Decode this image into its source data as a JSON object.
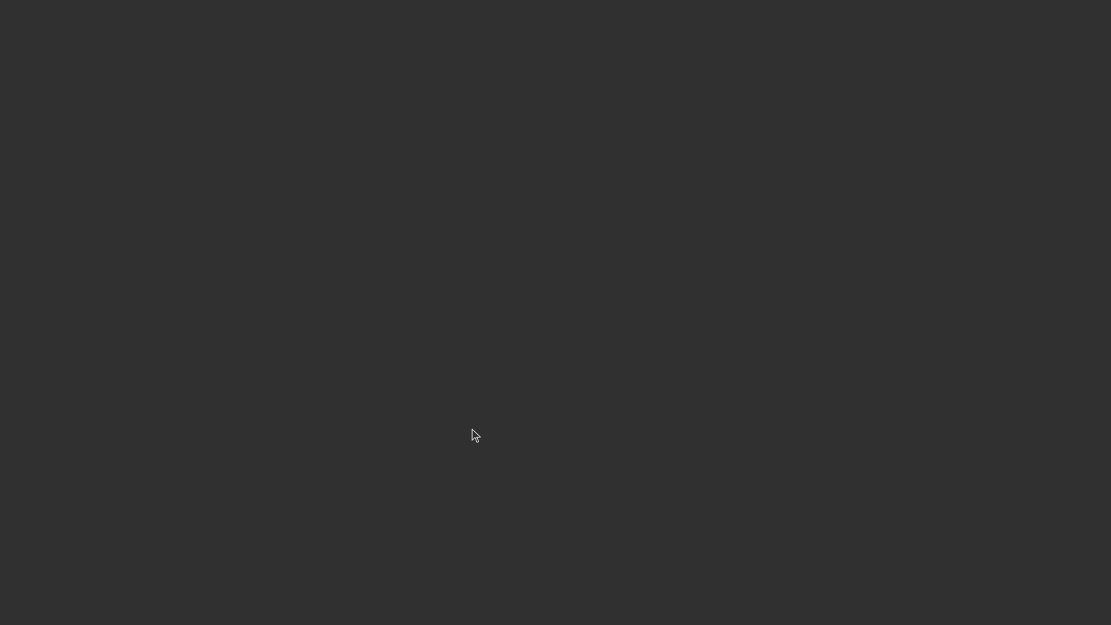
{
  "screen": {
    "background_color": "#303030"
  },
  "cursor": {
    "icon": "mouse-pointer-arrow-icon",
    "fill_color": "#303030",
    "outline_color": "#d8d8d8"
  }
}
